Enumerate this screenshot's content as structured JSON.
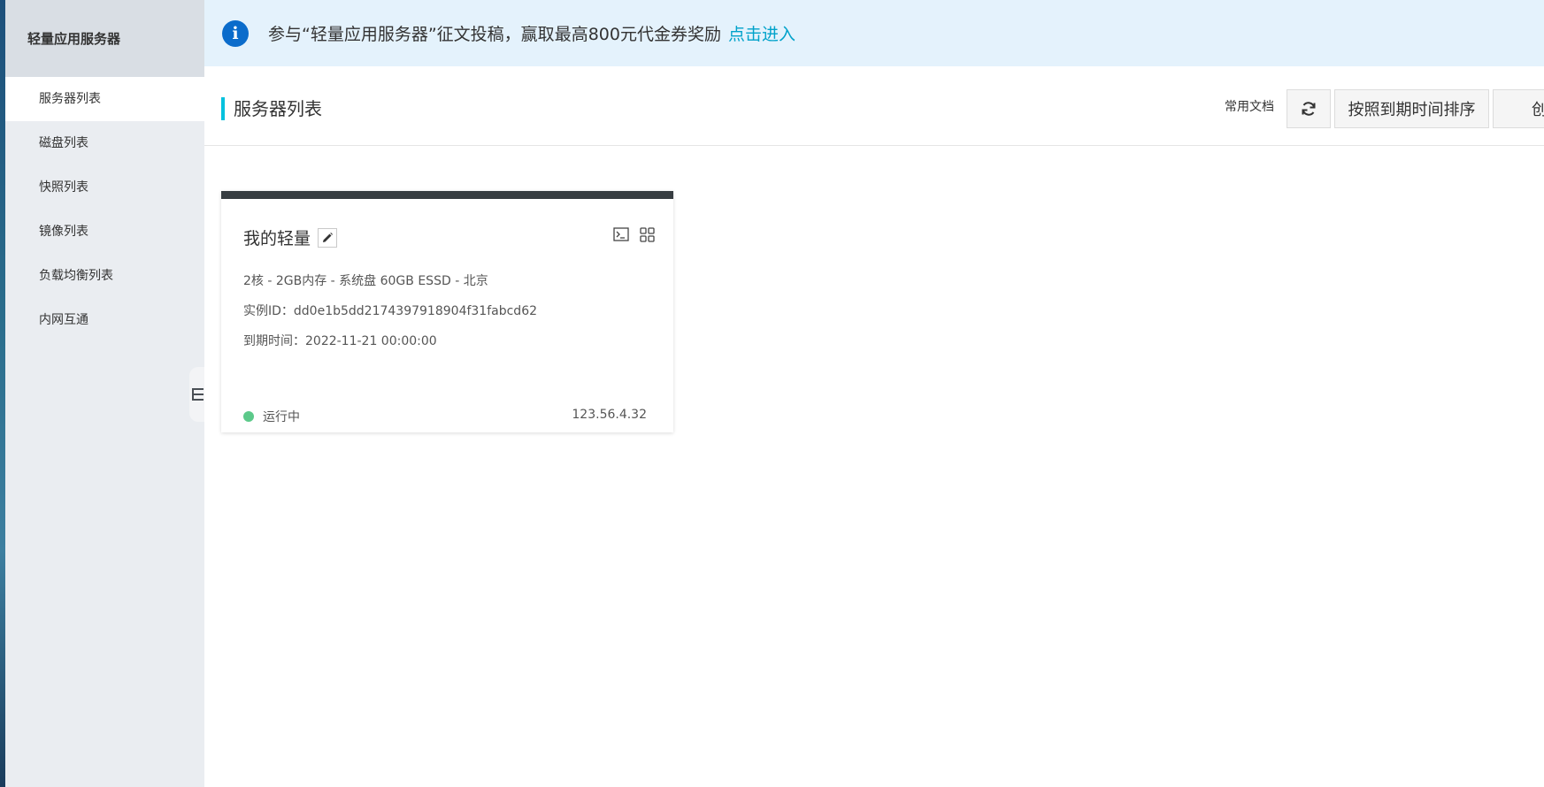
{
  "sidebar": {
    "title": "轻量应用服务器",
    "items": [
      {
        "label": "服务器列表",
        "active": true
      },
      {
        "label": "磁盘列表"
      },
      {
        "label": "快照列表"
      },
      {
        "label": "镜像列表"
      },
      {
        "label": "负载均衡列表"
      },
      {
        "label": "内网互通"
      }
    ]
  },
  "notice": {
    "text": "参与“轻量应用服务器”征文投稿，赢取最高800元代金券奖励",
    "link": "点击进入",
    "icon": "info-icon"
  },
  "header": {
    "title": "服务器列表",
    "docs": "常用文档",
    "refresh_icon": "refresh-icon",
    "sort_label": "按照到期时间排序",
    "create_label": "创建"
  },
  "card": {
    "name": "我的轻量",
    "spec": "2核 - 2GB内存 - 系统盘 60GB ESSD - 北京",
    "instance_id": "实例ID：dd0e1b5dd2174397918904f31fabcd62",
    "expire": "到期时间：2022-11-21 00:00:00",
    "status": "运行中",
    "ip": "123.56.4.32",
    "status_color": "#5cc98a",
    "header_color": "#373d41"
  },
  "colors": {
    "accent": "#00c1de",
    "link": "#00a2ca",
    "info": "#0b6ccb"
  }
}
